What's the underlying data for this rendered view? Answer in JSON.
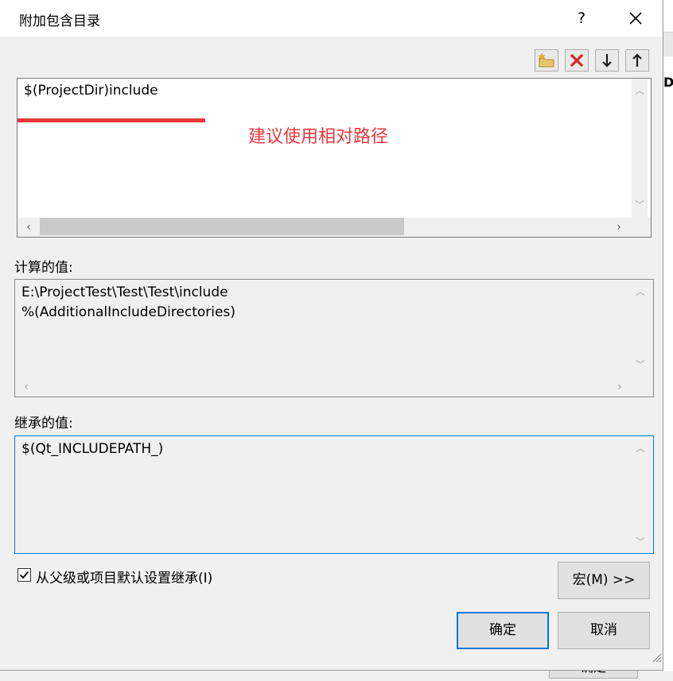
{
  "dialog": {
    "title": "附加包含目录",
    "help_label": "?",
    "close_label": "✕"
  },
  "toolbar": {
    "items": [
      {
        "name": "new-line-icon"
      },
      {
        "name": "delete-icon"
      },
      {
        "name": "move-down-icon"
      },
      {
        "name": "move-up-icon"
      }
    ]
  },
  "edit_box": {
    "value": "$(ProjectDir)include"
  },
  "annotation": {
    "text": "建议使用相对路径",
    "color": "#e8383d"
  },
  "evaluated": {
    "label": "计算的值:",
    "lines": [
      "E:\\ProjectTest\\Test\\Test\\include",
      "%(AdditionalIncludeDirectories)"
    ]
  },
  "inherited": {
    "label": "继承的值:",
    "lines": [
      "$(Qt_INCLUDEPATH_)"
    ]
  },
  "inherit_checkbox": {
    "label": "从父级或项目默认设置继承(I)",
    "checked": true
  },
  "buttons": {
    "macros": "宏(M) >>",
    "ok": "确定",
    "cancel": "取消"
  },
  "background": {
    "partial_letter": "D",
    "partial_button": "确定"
  },
  "colors": {
    "accent": "#0078d7",
    "delete_red": "#d9262c"
  }
}
